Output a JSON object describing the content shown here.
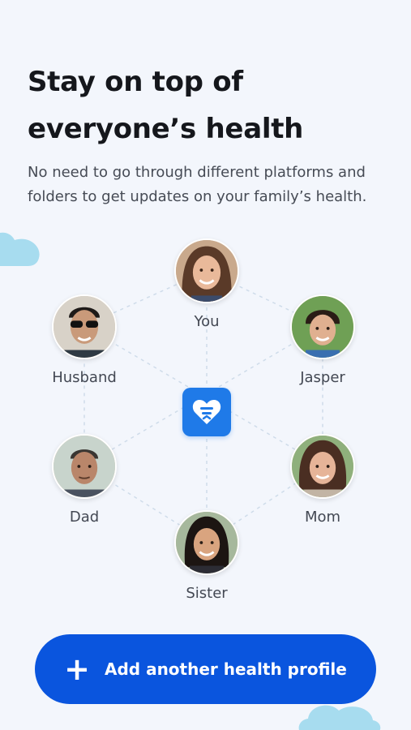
{
  "headline": {
    "line1": "Stay on top of",
    "line2": "everyone’s health"
  },
  "description": {
    "line1": "No need to go through different platforms and",
    "line2": "folders to get updates on your family’s health."
  },
  "family": {
    "members": [
      {
        "key": "you",
        "name": "You"
      },
      {
        "key": "husband",
        "name": "Husband"
      },
      {
        "key": "jasper",
        "name": "Jasper"
      },
      {
        "key": "dad",
        "name": "Dad"
      },
      {
        "key": "mom",
        "name": "Mom"
      },
      {
        "key": "sister",
        "name": "Sister"
      }
    ],
    "hub_icon": "heart-chat-icon"
  },
  "cta": {
    "icon": "plus-icon",
    "label": "Add another health profile"
  },
  "colors": {
    "background": "#f3f6fc",
    "primary_button": "#0a55de",
    "hub": "#1f7ae8",
    "cloud": "#a7dcef",
    "heading": "#15171c",
    "body_text": "#464b55"
  }
}
